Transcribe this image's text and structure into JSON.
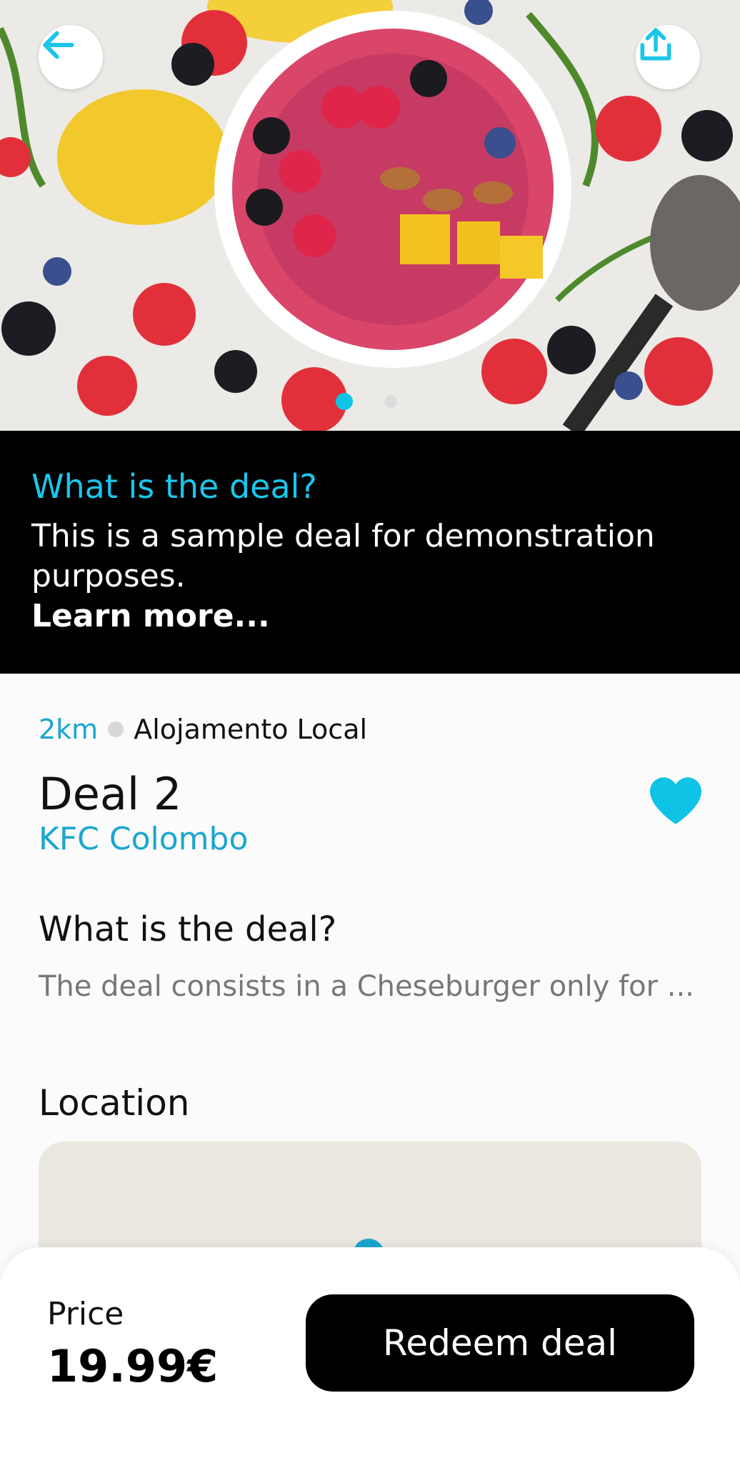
{
  "hero": {
    "back_icon": "arrow-left-icon",
    "share_icon": "share-upload-icon",
    "carousel": {
      "total": 2,
      "active_index": 0
    },
    "accent_color": "#0fc3e6"
  },
  "info_band": {
    "title": "What is the deal?",
    "text": "This is a sample deal for demonstration purposes.",
    "link": "Learn more..."
  },
  "deal": {
    "distance": "2km",
    "category": "Alojamento Local",
    "title": "Deal 2",
    "favorite_icon": "heart-icon",
    "favorited": true,
    "vendor": "KFC Colombo",
    "section_title": "What is the deal?",
    "description": "The deal consists in a Cheseburger only for ...",
    "location_title": "Location"
  },
  "bottom_bar": {
    "price_label": "Price",
    "price_value": "19.99€",
    "redeem_label": "Redeem deal"
  },
  "colors": {
    "accent": "#1cc6ea",
    "link_blue": "#1aa6d0",
    "band_bg": "#000000"
  }
}
